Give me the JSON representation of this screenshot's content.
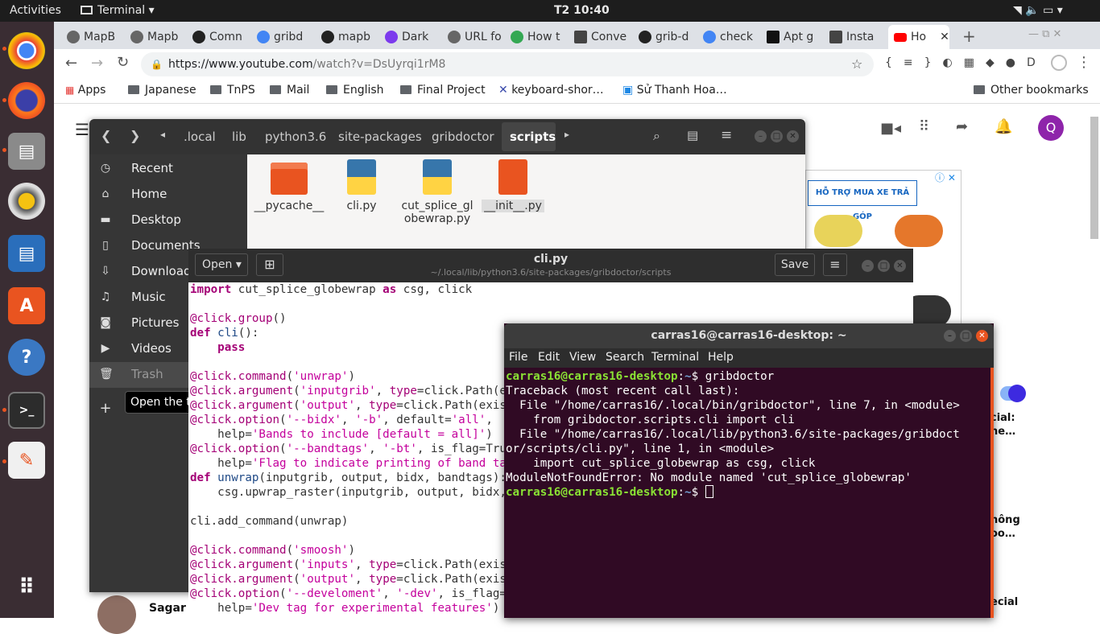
{
  "topbar": {
    "activities": "Activities",
    "app": "Terminal",
    "clock": "T2 10:40"
  },
  "dock": {
    "items": [
      "chrome",
      "firefox",
      "files",
      "rhythmbox",
      "writer",
      "software",
      "help",
      "terminal",
      "text-editor"
    ],
    "apps_grid": "show-apps"
  },
  "chrome": {
    "tabs": [
      {
        "label": "MapB"
      },
      {
        "label": "Mapb"
      },
      {
        "label": "Comn"
      },
      {
        "label": "gribd"
      },
      {
        "label": "mapb"
      },
      {
        "label": "Dark"
      },
      {
        "label": "URL fo"
      },
      {
        "label": "How t"
      },
      {
        "label": "Conve"
      },
      {
        "label": "grib-d"
      },
      {
        "label": "check"
      },
      {
        "label": "Apt g"
      },
      {
        "label": "Insta"
      },
      {
        "label": "Ho"
      }
    ],
    "url": "https://www.youtube.com/watch?v=DsUyrqi1rM8",
    "url_host": "https://www.youtube.com",
    "url_path": "/watch?v=DsUyrqi1rM8",
    "bookmarks": [
      "Apps",
      "Japanese",
      "TnPS",
      "Mail",
      "English",
      "Final Project",
      "keyboard-shor…",
      "Sử Thanh Hoa…"
    ],
    "other_bookmarks": "Other bookmarks",
    "profile_initial": "Q",
    "ad_text": "HỖ TRỢ MUA XE TRẢ GÓP",
    "side_texts": [
      "cial:",
      "ne…",
      "hông",
      "oo…",
      "ecial"
    ],
    "commenter": "Sagar S"
  },
  "nautilus": {
    "path": [
      ".local",
      "lib",
      "python3.6",
      "site-packages",
      "gribdoctor",
      "scripts"
    ],
    "sidebar": [
      "Recent",
      "Home",
      "Desktop",
      "Documents",
      "Downloads",
      "Music",
      "Pictures",
      "Videos",
      "Trash"
    ],
    "tooltip": "Open the trash",
    "files": [
      {
        "name": "__pycache__"
      },
      {
        "name": "cli.py"
      },
      {
        "name": "cut_splice_globewrap.py"
      },
      {
        "name": "__init__.py"
      }
    ]
  },
  "gedit": {
    "open": "Open",
    "title": "cli.py",
    "subtitle": "~/.local/lib/python3.6/site-packages/gribdoctor/scripts",
    "save": "Save"
  },
  "terminal": {
    "title": "carras16@carras16-desktop: ~",
    "menu": [
      "File",
      "Edit",
      "View",
      "Search",
      "Terminal",
      "Help"
    ],
    "prompt_user": "carras16@carras16-desktop",
    "prompt_path": "~",
    "command": "gribdoctor",
    "output": [
      "Traceback (most recent call last):",
      "  File \"/home/carras16/.local/bin/gribdoctor\", line 7, in <module>",
      "    from gribdoctor.scripts.cli import cli",
      "  File \"/home/carras16/.local/lib/python3.6/site-packages/gribdoct",
      "or/scripts/cli.py\", line 1, in <module>",
      "    import cut_splice_globewrap as csg, click",
      "ModuleNotFoundError: No module named 'cut_splice_globewrap'"
    ]
  }
}
